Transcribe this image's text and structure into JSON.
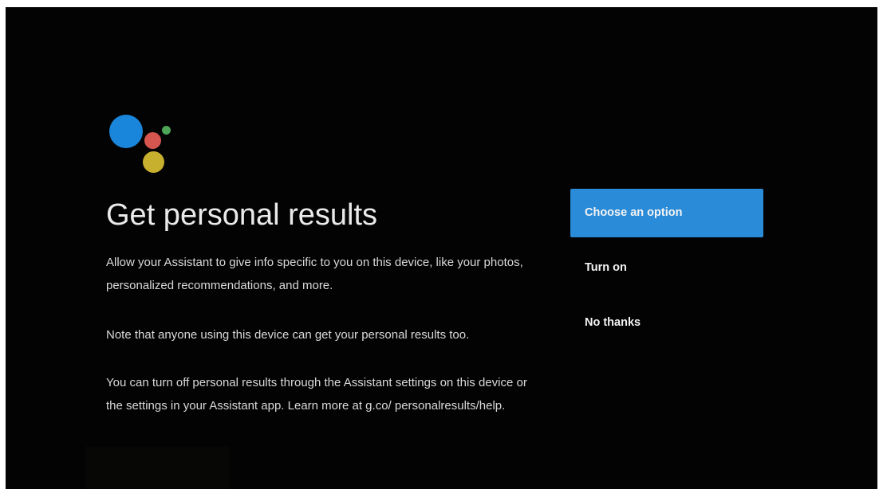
{
  "colors": {
    "background": "#030303",
    "accent": "#2a8bd8",
    "logo_blue": "#1a86db",
    "logo_red": "#d5564f",
    "logo_green": "#4ea457",
    "logo_yellow": "#c8b02f"
  },
  "logo": {
    "icon": "google-assistant-icon"
  },
  "main": {
    "title": "Get personal results",
    "paragraphs": [
      "Allow your Assistant to give info specific to you on this device, like your photos, personalized recommendations, and more.",
      "Note that anyone using this device can get your personal results too.",
      "You can turn off personal results through the Assistant settings on this device or the settings in your Assistant app. Learn more at g.co/ personalresults/help."
    ]
  },
  "menu": {
    "options": [
      {
        "label": "Choose an option",
        "selected": true
      },
      {
        "label": "Turn on",
        "selected": false
      },
      {
        "label": "No thanks",
        "selected": false
      }
    ]
  }
}
